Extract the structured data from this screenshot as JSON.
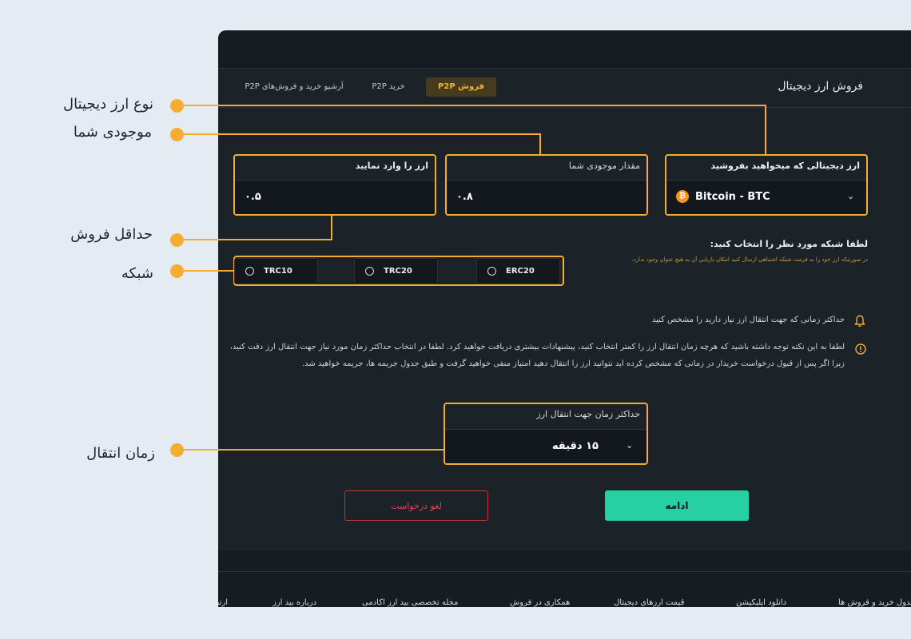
{
  "header": {
    "page_title": "فروش ارز دیجیتال",
    "tabs": [
      {
        "label": "فروش P2P",
        "active": true
      },
      {
        "label": "خرید P2P",
        "active": false
      },
      {
        "label": "آرشیو خرید و فروش‌های P2P",
        "active": false
      }
    ]
  },
  "form": {
    "currency_field": {
      "label": "ارز دیجیتالی که میخواهید بفروشید",
      "value": "Bitcoin - BTC",
      "icon": "bitcoin-icon"
    },
    "balance_field": {
      "label": "مقدار موجودی شما",
      "value": "۰.۸"
    },
    "amount_field": {
      "label": "ارز را وارد نمایید",
      "value": "۰.۵"
    },
    "network": {
      "title": "لطفا شبکه مورد نظر را انتخاب کنید:",
      "note": "در صورتیکه ارز خود را به فرمت شبکه اشتباهی ارسال کنید امکان بازیابی آن به هیچ عنوان وجود ندارد.",
      "options": [
        "ERC20",
        "TRC20",
        "TRC10"
      ]
    },
    "time_hint": "حداکثر زمانی که جهت انتقال ارز نیاز دارید را مشخص کنید",
    "warning_line1": "لطفا به این نکته توجه داشته باشید که هرچه زمان انتقال ارز را کمتر انتخاب کنید، پیشنهادات بیشتری دریافت خواهید کرد. لطفا در انتخاب حداکثر زمان مورد نیاز جهت انتقال ارز دقت کنید،",
    "warning_line2": "زیرا اگر پس از  قبول درخواست خریدار در زمانی که مشخص کرده اید نتوانید ارز را انتقال دهید امتیاز منفی خواهید گرفت و طبق جدول جریمه ها، جریمه خواهید شد.",
    "time_field": {
      "label": "حداکثر زمان جهت انتقال ارز",
      "value": "۱۵ دقیقه"
    },
    "continue_label": "ادامه",
    "cancel_label": "لغو درخواست"
  },
  "footer": {
    "links": [
      "جدول خرید و فروش ها",
      "دانلود اپلیکیشن",
      "قیمت ارزهای دیجیتال",
      "همکاری در فروش",
      "مجله تخصصی بید ارز اکادمی",
      "درباره بید ارز",
      "ارتباط"
    ]
  },
  "annotations": {
    "currency_type": "نوع ارز دیجیتال",
    "your_balance": "موجودی شما",
    "min_sale": "حداقل فروش",
    "network": "شبکه",
    "transfer_time": "زمان انتقال"
  },
  "colors": {
    "accent": "#f4ad30",
    "continue": "#26d0a3",
    "cancel": "#e2474f",
    "panel": "#1b2228"
  }
}
